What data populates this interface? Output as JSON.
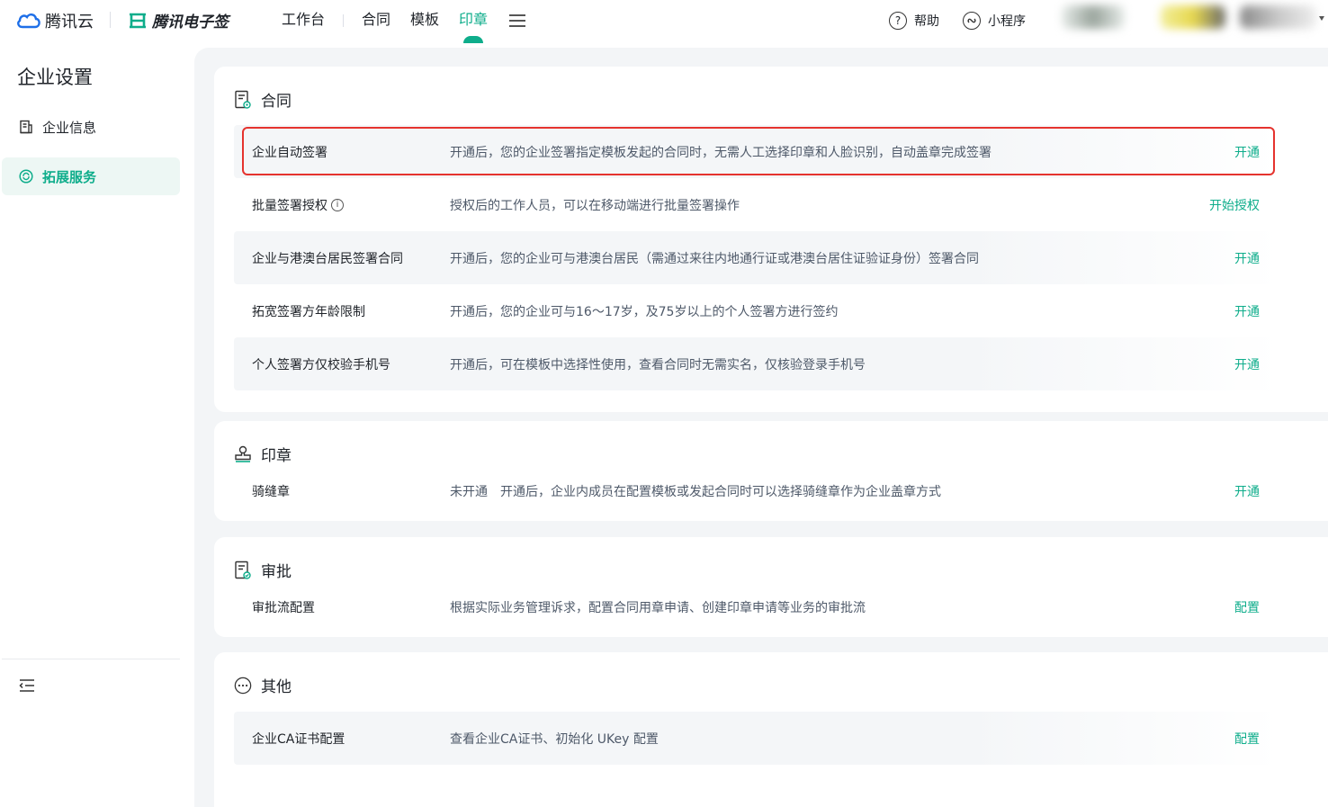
{
  "header": {
    "brand_tencent_cloud": "腾讯云",
    "brand_esign": "腾讯电子签",
    "nav": [
      {
        "label": "工作台"
      },
      {
        "label": "合同"
      },
      {
        "label": "模板"
      },
      {
        "label": "印章"
      }
    ],
    "active_nav": "印章",
    "help_label": "帮助",
    "miniprogram_label": "小程序"
  },
  "sidebar": {
    "title": "企业设置",
    "items": [
      {
        "label": "企业信息",
        "icon": "building-doc-icon"
      },
      {
        "label": "拓展服务",
        "icon": "refresh-circle-icon",
        "active": true
      }
    ]
  },
  "sections": {
    "contract": {
      "title": "合同",
      "icon": "contract-doc-icon",
      "rows": [
        {
          "name": "企业自动签署",
          "desc": "开通后，您的企业签署指定模板发起的合同时，无需人工选择印章和人脸识别，自动盖章完成签署",
          "action": "开通"
        },
        {
          "name": "批量签署授权",
          "desc": "授权后的工作人员，可以在移动端进行批量签署操作",
          "action": "开始授权"
        },
        {
          "name": "企业与港澳台居民签署合同",
          "desc": "开通后，您的企业可与港澳台居民（需通过来往内地通行证或港澳台居住证验证身份）签署合同",
          "action": "开通"
        },
        {
          "name": "拓宽签署方年龄限制",
          "desc": "开通后，您的企业可与16～17岁，及75岁以上的个人签署方进行签约",
          "action": "开通"
        },
        {
          "name": "个人签署方仅校验手机号",
          "desc": "开通后，可在模板中选择性使用，查看合同时无需实名，仅核验登录手机号",
          "action": "开通"
        }
      ]
    },
    "seal": {
      "title": "印章",
      "icon": "stamp-icon",
      "rows": [
        {
          "name": "骑缝章",
          "desc": "未开通　开通后，企业内成员在配置模板或发起合同时可以选择骑缝章作为企业盖章方式",
          "action": "开通"
        }
      ]
    },
    "approval": {
      "title": "审批",
      "icon": "approval-doc-icon",
      "rows": [
        {
          "name": "审批流配置",
          "desc": "根据实际业务管理诉求，配置合同用章申请、创建印章申请等业务的审批流",
          "action": "配置"
        }
      ]
    },
    "other": {
      "title": "其他",
      "icon": "more-circle-icon",
      "rows": [
        {
          "name": "企业CA证书配置",
          "desc": "查看企业CA证书、初始化 UKey 配置",
          "action": "配置"
        }
      ]
    }
  },
  "colors": {
    "accent": "#0ead8b",
    "highlight_border": "#e5332e"
  }
}
